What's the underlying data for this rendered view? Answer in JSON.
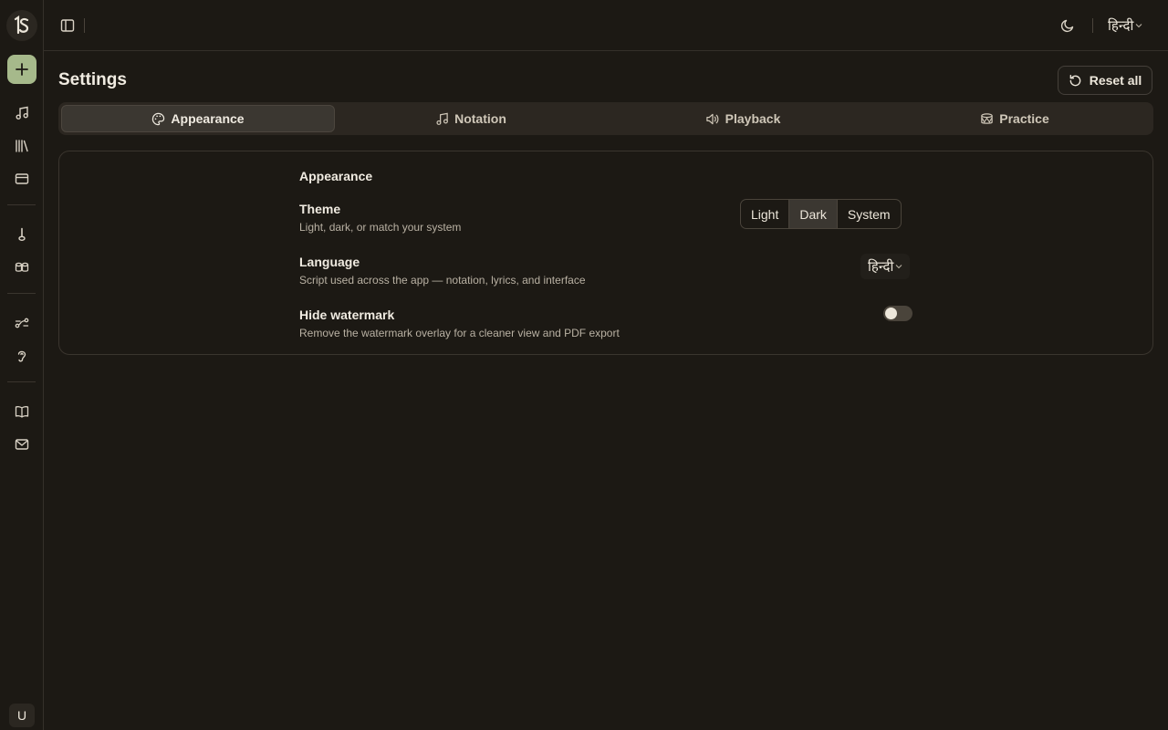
{
  "app": {
    "logo_text": "ꟾS",
    "avatar_initial": "U",
    "accent_color": "#a6b98b"
  },
  "sidebar": {
    "icons": [
      "plus-icon",
      "music-note-icon",
      "library-icon",
      "card-icon",
      "flute-icon",
      "drums-icon",
      "path-icon",
      "ear-icon",
      "book-icon",
      "mail-icon"
    ]
  },
  "topbar": {
    "language_label": "हिन्दी"
  },
  "page": {
    "title": "Settings",
    "reset_label": "Reset all"
  },
  "tabs": [
    {
      "label": "Appearance",
      "icon": "palette-icon",
      "active": true
    },
    {
      "label": "Notation",
      "icon": "music-note-icon",
      "active": false
    },
    {
      "label": "Playback",
      "icon": "speaker-icon",
      "active": false
    },
    {
      "label": "Practice",
      "icon": "practice-icon",
      "active": false
    }
  ],
  "appearance": {
    "section_title": "Appearance",
    "theme": {
      "label": "Theme",
      "description": "Light, dark, or match your system",
      "options": [
        "Light",
        "Dark",
        "System"
      ],
      "selected": "Dark"
    },
    "language": {
      "label": "Language",
      "description": "Script used across the app — notation, lyrics, and interface",
      "value": "हिन्दी"
    },
    "watermark": {
      "label": "Hide watermark",
      "description": "Remove the watermark overlay for a cleaner view and PDF export",
      "enabled": false
    }
  }
}
